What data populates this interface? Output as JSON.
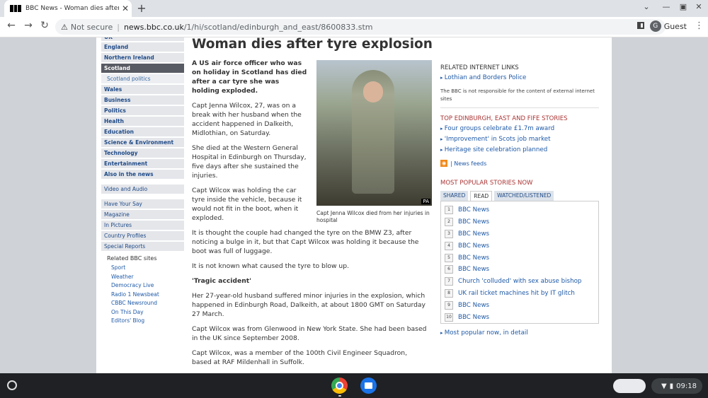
{
  "browser": {
    "tab_title": "BBC News - Woman dies after ty",
    "tab_close": "✕",
    "new_tab": "+",
    "url_security": "Not secure",
    "url_host": "news.bbc.co.uk",
    "url_path": "/1/hi/scotland/edinburgh_and_east/8600833.stm",
    "profile": "Guest",
    "profile_initial": "G"
  },
  "leftnav": {
    "top_cut": "UK",
    "items": [
      "England",
      "Northern Ireland",
      "Scotland",
      "Scotland politics",
      "Wales",
      "Business",
      "Politics",
      "Health",
      "Education",
      "Science & Environment",
      "Technology",
      "Entertainment",
      "Also in the news"
    ],
    "media": "Video and Audio",
    "extras": [
      "Have Your Say",
      "Magazine",
      "In Pictures",
      "Country Profiles",
      "Special Reports"
    ],
    "related_heading": "Related BBC sites",
    "related": [
      "Sport",
      "Weather",
      "Democracy Live",
      "Radio 1 Newsbeat",
      "CBBC Newsround",
      "On This Day",
      "Editors' Blog"
    ]
  },
  "article": {
    "headline": "Woman dies after tyre explosion",
    "lead": "A US air force officer who was on holiday in Scotland has died after a car tyre she was holding exploded.",
    "p1": "Capt Jenna Wilcox, 27, was on a break with her husband when the accident happened in Dalkeith, Midlothian, on Saturday.",
    "p2": "She died at the Western General Hospital in Edinburgh on Thursday, five days after she sustained the injuries.",
    "p3": "Capt Wilcox was holding the car tyre inside the vehicle, because it would not fit in the boot, when it exploded.",
    "p4": "It is thought the couple had changed the tyre on the BMW Z3, after noticing a bulge in it, but that Capt Wilcox was holding it because the boot was full of luggage.",
    "p5": "It is not known what caused the tyre to blow up.",
    "subhead": "'Tragic accident'",
    "p6": "Her 27-year-old husband suffered minor injuries in the explosion, which happened in Edinburgh Road, Dalkeith, at about 1800 GMT on Saturday 27 March.",
    "p7": "Capt Wilcox was from Glenwood in New York State. She had been based in the UK since September 2008.",
    "p8": "Capt Wilcox, was a member of the 100th Civil Engineer Squadron, based at RAF Mildenhall in Suffolk.",
    "photo_credit": "PA",
    "caption": "Capt Jenna Wilcox died from her injuries in hospital"
  },
  "right": {
    "links_heading": "RELATED INTERNET LINKS",
    "links": [
      "Lothian and Borders Police"
    ],
    "disclaimer": "The BBC is not responsible for the content of external internet sites",
    "top_heading": "TOP EDINBURGH, EAST AND FIFE STORIES",
    "top": [
      "Four groups celebrate £1.7m award",
      "'Improvement' in Scots job market",
      "Heritage site celebration planned"
    ],
    "feeds": "| News feeds",
    "popular_heading": "MOST POPULAR STORIES NOW",
    "tabs": [
      "SHARED",
      "READ",
      "WATCHED/LISTENED"
    ],
    "popular": [
      "BBC News",
      "BBC News",
      "BBC News",
      "BBC News",
      "BBC News",
      "BBC News",
      "Church 'colluded' with sex abuse bishop",
      "UK rail ticket machines hit by IT glitch",
      "BBC News",
      "BBC News"
    ],
    "more": "Most popular now, in detail"
  },
  "taskbar": {
    "time": "09:18"
  }
}
